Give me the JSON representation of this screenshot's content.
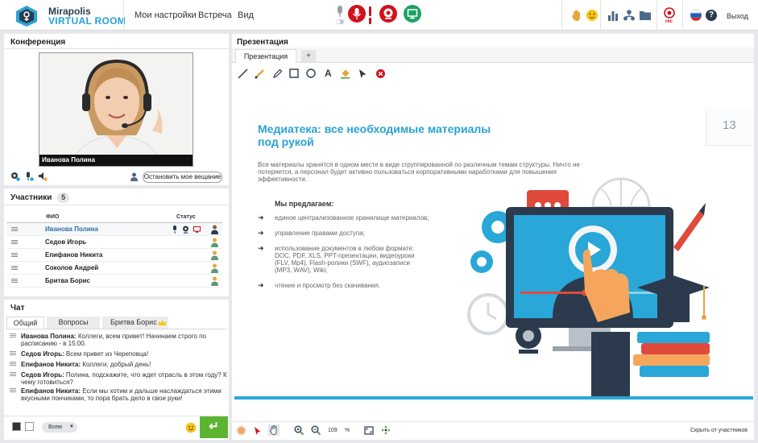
{
  "app": {
    "logo_line1": "Mirapolis",
    "logo_line2": "VIRTUAL ROOM",
    "menu": [
      "Мои настройки",
      "Встреча",
      "Вид"
    ],
    "rec_label": "rec",
    "exit_label": "Выход"
  },
  "conference": {
    "title": "Конференция",
    "video_name": "Иванова Полина",
    "stop_button": "Остановить мое вещание"
  },
  "participants": {
    "title": "Участники",
    "count": "5",
    "col_name": "ФИО",
    "col_status": "Статус",
    "rows": [
      {
        "name": "Иванова Полина"
      },
      {
        "name": "Седов Игорь"
      },
      {
        "name": "Епифанов Никита"
      },
      {
        "name": "Соколов Андрей"
      },
      {
        "name": "Бритва Борис"
      }
    ]
  },
  "chat": {
    "title": "Чат",
    "tabs": [
      "Общий",
      "Вопросы",
      "Бритва Борис"
    ],
    "messages": [
      {
        "author": "Иванова Полина:",
        "text": "Коллеги, всем привет! Начинаем строго по расписанию - в 15:00."
      },
      {
        "author": "Седов Игорь:",
        "text": "Всем привет из Череповца!"
      },
      {
        "author": "Епифанов Никита:",
        "text": "Коллеги, добрый день!"
      },
      {
        "author": "Седов Игорь:",
        "text": "Полина, подскажите, что ждет отрасль в этом году? К чему готовиться?"
      },
      {
        "author": "Епифанов Никита:",
        "text": "Если мы хотим и дальше наслаждаться этими вкусными пончиками, то пора брать дело в свои руки!"
      }
    ],
    "recipient": "Всем"
  },
  "presentation": {
    "title": "Презентация",
    "tab": "Презентация",
    "add_tab": "+",
    "slide": {
      "heading": "Медиатека: все необходимые материалы под рукой",
      "page_number": "13",
      "intro": "Все материалы хранятся в одном месте в виде сгруппированной по различным темам структуры. Ничто не потеряется, а персонал будет активно пользоваться корпоративными наработками для повышения эффективности.",
      "subheading": "Мы предлагаем:",
      "arrow": "➜",
      "bullets": [
        "единое централизованное хранилище материалов;",
        "управление правами доступа;",
        "использование документов в любом формате: DOC, PDF, XLS, PPT-презентации, видеоуроки (FLV, Mp4), Flash-ролики (SWF), аудиозаписи (MP3, WAV), Wiki;",
        "чтение и просмотр без скачивания."
      ]
    },
    "zoom_value": "109",
    "zoom_unit": "%",
    "hide_label": "Скрыть от участников"
  },
  "colors": {
    "accent": "#27a3d4",
    "record_red": "#d0121b",
    "screen_green": "#1ba262",
    "send_green": "#5cb531",
    "own_name": "#2e6ea6"
  }
}
